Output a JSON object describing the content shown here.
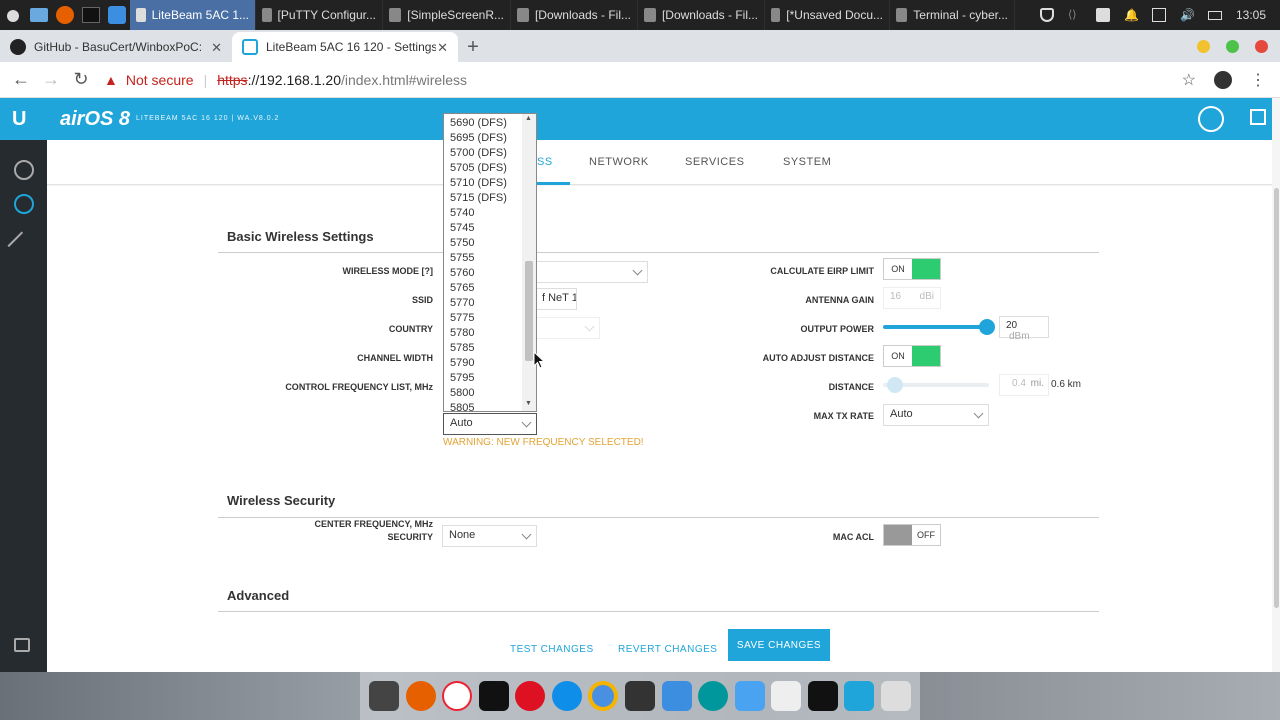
{
  "os_panel": {
    "tasks": [
      {
        "label": "LiteBeam 5AC 1...",
        "active": true,
        "icon": "chrome-icon"
      },
      {
        "label": "[PuTTY Configur...",
        "active": false,
        "icon": "putty-icon"
      },
      {
        "label": "[SimpleScreenR...",
        "active": false,
        "icon": "camera-icon"
      },
      {
        "label": "[Downloads - Fil...",
        "active": false,
        "icon": "folder-icon"
      },
      {
        "label": "[Downloads - Fil...",
        "active": false,
        "icon": "folder-icon"
      },
      {
        "label": "[*Unsaved Docu...",
        "active": false,
        "icon": "document-icon"
      },
      {
        "label": "Terminal - cyber...",
        "active": false,
        "icon": "terminal-icon"
      }
    ],
    "clock": "13:05"
  },
  "browser": {
    "tabs": [
      {
        "label": "GitHub - BasuCert/WinboxPoC: ...",
        "active": false
      },
      {
        "label": "LiteBeam 5AC 16 120 - Settings",
        "active": true
      }
    ],
    "new_tab": "+",
    "security_label": "Not secure",
    "url_scheme": "https",
    "url_host": "://192.168.1.20",
    "url_path": "/index.html#wireless"
  },
  "airos": {
    "logo": "U",
    "brand": "airOS 8",
    "device_info": "LITEBEAM 5AC 16 120 | WA.V8.0.2",
    "tabs": [
      {
        "label": "WIRELESS",
        "visible": "SS",
        "active": true
      },
      {
        "label": "NETWORK",
        "active": false
      },
      {
        "label": "SERVICES",
        "active": false
      },
      {
        "label": "SYSTEM",
        "active": false
      }
    ],
    "basic": {
      "title": "Basic Wireless Settings",
      "wireless_mode_label": "WIRELESS MODE [?]",
      "ssid_label": "SSID",
      "ssid_value": "f NeT 1",
      "country_label": "COUNTRY",
      "channel_width_label": "CHANNEL WIDTH",
      "control_freq_label": "CONTROL FREQUENCY LIST, MHz",
      "center_freq_label": "CENTER FREQUENCY, MHz",
      "center_freq_value": "Auto",
      "warning": "WARNING: NEW FREQUENCY SELECTED!",
      "eirp_label": "CALCULATE EIRP LIMIT",
      "eirp_state": "ON",
      "antenna_gain_label": "ANTENNA GAIN",
      "antenna_gain_value": "16",
      "antenna_gain_unit": "dBi",
      "output_power_label": "OUTPUT POWER",
      "output_power_value": "20",
      "output_power_unit": "dBm",
      "output_power_level": 1.0,
      "auto_distance_label": "AUTO ADJUST DISTANCE",
      "auto_distance_state": "ON",
      "distance_label": "DISTANCE",
      "distance_value": "0.4",
      "distance_unit": "mi.",
      "distance_km": "0.6 km",
      "max_tx_label": "MAX TX RATE",
      "max_tx_value": "Auto"
    },
    "frequency_options": [
      "5690 (DFS)",
      "5695 (DFS)",
      "5700 (DFS)",
      "5705 (DFS)",
      "5710 (DFS)",
      "5715 (DFS)",
      "5740",
      "5745",
      "5750",
      "5755",
      "5760",
      "5765",
      "5770",
      "5775",
      "5780",
      "5785",
      "5790",
      "5795",
      "5800",
      "5805"
    ],
    "security": {
      "title": "Wireless Security",
      "security_label": "SECURITY",
      "security_value": "None",
      "mac_acl_label": "MAC ACL",
      "mac_acl_state": "OFF"
    },
    "advanced_title": "Advanced",
    "footer": {
      "test": "TEST CHANGES",
      "revert": "REVERT CHANGES",
      "save": "SAVE CHANGES"
    }
  },
  "colors": {
    "accent": "#1fa5d9",
    "toggle_on": "#2ecc71",
    "warning": "#e2a336"
  }
}
